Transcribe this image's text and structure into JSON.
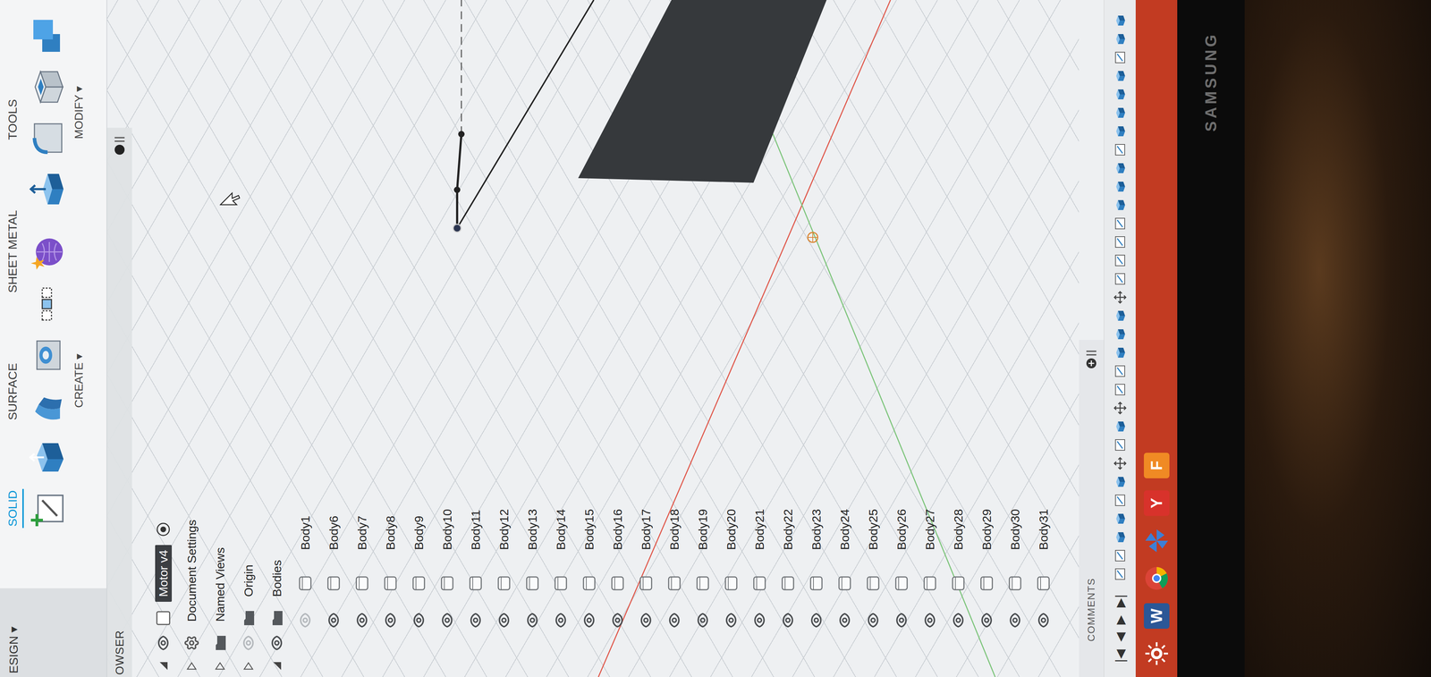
{
  "toolbar": {
    "workspace": "ESIGN ▾",
    "tabs": [
      {
        "label": "SOLID",
        "selected": true
      },
      {
        "label": "SURFACE",
        "selected": false
      },
      {
        "label": "SHEET METAL",
        "selected": false
      },
      {
        "label": "TOOLS",
        "selected": false
      }
    ],
    "groups": [
      {
        "label": "CREATE ▾",
        "tools": [
          {
            "kind": "sketch"
          },
          {
            "kind": "extrude"
          },
          {
            "kind": "revolve"
          },
          {
            "kind": "hole"
          },
          {
            "kind": "pattern"
          },
          {
            "kind": "form"
          }
        ]
      },
      {
        "label": "MODIFY ▾",
        "tools": [
          {
            "kind": "presspull"
          },
          {
            "kind": "fillet"
          },
          {
            "kind": "shell"
          },
          {
            "kind": "combine"
          }
        ]
      }
    ]
  },
  "browser": {
    "title": "OWSER",
    "items": [
      {
        "label": "Motor v4",
        "kind": "root",
        "expanded": true,
        "selected": true,
        "visible": true,
        "active": true
      },
      {
        "label": "Document Settings",
        "kind": "settings",
        "expanded": false,
        "selected": false
      },
      {
        "label": "Named Views",
        "kind": "folder",
        "expanded": false,
        "selected": false
      },
      {
        "label": "Origin",
        "kind": "folder",
        "expanded": false,
        "selected": false,
        "visible": false
      },
      {
        "label": "Bodies",
        "kind": "folder",
        "expanded": true,
        "selected": false,
        "visible": true
      }
    ],
    "bodies": [
      {
        "label": "Body1",
        "visible": false
      },
      {
        "label": "Body6",
        "visible": true
      },
      {
        "label": "Body7",
        "visible": true
      },
      {
        "label": "Body8",
        "visible": true
      },
      {
        "label": "Body9",
        "visible": true
      },
      {
        "label": "Body10",
        "visible": true
      },
      {
        "label": "Body11",
        "visible": true
      },
      {
        "label": "Body12",
        "visible": true
      },
      {
        "label": "Body13",
        "visible": true
      },
      {
        "label": "Body14",
        "visible": true
      },
      {
        "label": "Body15",
        "visible": true
      },
      {
        "label": "Body16",
        "visible": true
      },
      {
        "label": "Body17",
        "visible": true
      },
      {
        "label": "Body18",
        "visible": true
      },
      {
        "label": "Body19",
        "visible": true
      },
      {
        "label": "Body20",
        "visible": true
      },
      {
        "label": "Body21",
        "visible": true
      },
      {
        "label": "Body22",
        "visible": true
      },
      {
        "label": "Body23",
        "visible": true
      },
      {
        "label": "Body24",
        "visible": true
      },
      {
        "label": "Body25",
        "visible": true
      },
      {
        "label": "Body26",
        "visible": true
      },
      {
        "label": "Body27",
        "visible": true
      },
      {
        "label": "Body28",
        "visible": true
      },
      {
        "label": "Body29",
        "visible": true
      },
      {
        "label": "Body30",
        "visible": true
      },
      {
        "label": "Body31",
        "visible": true
      }
    ]
  },
  "comments": {
    "label": "COMMENTS"
  },
  "timeline": {
    "controls": [
      "|◀",
      "◀",
      "▶",
      "▶|"
    ],
    "features": [
      {
        "kind": "sketch"
      },
      {
        "kind": "sketch"
      },
      {
        "kind": "extrude"
      },
      {
        "kind": "extrude"
      },
      {
        "kind": "sketch"
      },
      {
        "kind": "extrude"
      },
      {
        "kind": "move"
      },
      {
        "kind": "sketch"
      },
      {
        "kind": "extrude"
      },
      {
        "kind": "move"
      },
      {
        "kind": "sketch"
      },
      {
        "kind": "sketch"
      },
      {
        "kind": "extrude"
      },
      {
        "kind": "extrude"
      },
      {
        "kind": "extrude"
      },
      {
        "kind": "move"
      },
      {
        "kind": "sketch"
      },
      {
        "kind": "sketch"
      },
      {
        "kind": "sketch"
      },
      {
        "kind": "sketch"
      },
      {
        "kind": "extrude"
      },
      {
        "kind": "extrude"
      },
      {
        "kind": "extrude"
      },
      {
        "kind": "sketch"
      },
      {
        "kind": "extrude"
      },
      {
        "kind": "extrude"
      },
      {
        "kind": "extrude"
      },
      {
        "kind": "extrude"
      },
      {
        "kind": "sketch"
      },
      {
        "kind": "extrude"
      },
      {
        "kind": "extrude"
      }
    ]
  },
  "taskbar": {
    "apps": [
      {
        "kind": "start"
      },
      {
        "kind": "word",
        "label": "W",
        "color": "#2b5797"
      },
      {
        "kind": "chrome"
      },
      {
        "kind": "pinwheel"
      },
      {
        "kind": "yahoo",
        "label": "Y",
        "color": "#d8322b"
      },
      {
        "kind": "fusion",
        "label": "F",
        "color": "#f08a24"
      }
    ]
  },
  "monitor": {
    "brand": "SAMSUNG"
  }
}
